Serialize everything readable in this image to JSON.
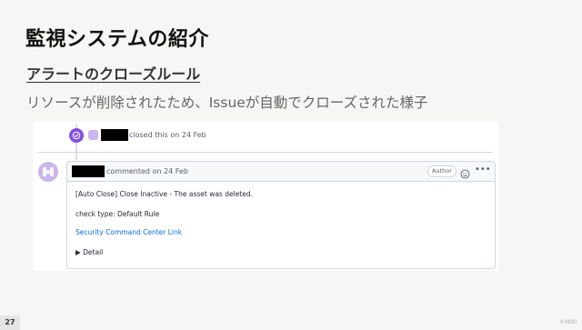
{
  "slide": {
    "title": "監視システムの紹介",
    "subtitle": "アラートのクローズルール",
    "description": "リソースが削除されたため、Issueが自動でクローズされた様子",
    "page_number": "27",
    "copyright": "©MIXI"
  },
  "timeline": {
    "event_text": "closed this on 24 Feb",
    "badge_color": "#8250df"
  },
  "comment": {
    "header_text": "commented on 24 Feb",
    "author_badge": "Author",
    "body": {
      "line1": "[Auto Close] Close Inactive - The asset was deleted.",
      "line2": "check type: Default Rule",
      "link": "Security Command Center Link",
      "details": "▶ Detail"
    },
    "link_color": "#0969da"
  },
  "icons": {
    "closed": "check-circle-icon",
    "emoji": "smiley-icon",
    "more": "kebab-menu-icon"
  }
}
